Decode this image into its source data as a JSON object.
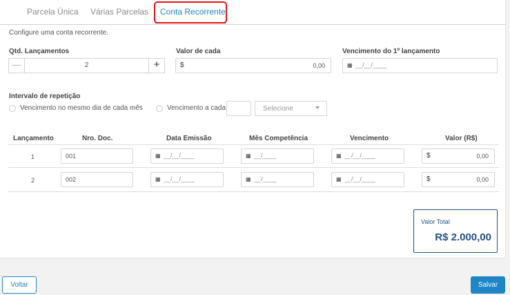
{
  "tabs": [
    "Parcela Única",
    "Várias Parcelas",
    "Conta Recorrente"
  ],
  "description": "Configure uma conta recorrente.",
  "qtd": {
    "label": "Qtd. Lançamentos",
    "minus": "—",
    "plus": "+",
    "value": "2"
  },
  "valor_cada": {
    "label": "Valor de cada",
    "currency": "$",
    "value": "0,00"
  },
  "vencimento_primeiro": {
    "label": "Vencimento do 1º lançamento",
    "placeholder": "__/__/____"
  },
  "intervalo": {
    "label": "Intervalo de repetição",
    "option1": "Vencimento no mesmo dia de cada mês",
    "option2": "Vencimento a cada",
    "select_placeholder": "Selecione"
  },
  "table": {
    "headers": [
      "Lançamento",
      "Nro. Doc.",
      "Data Emissão",
      "Mês Competência",
      "Vencimento",
      "Valor (R$)"
    ],
    "rows": [
      {
        "num": "1",
        "doc": "001",
        "emissao": "__/__/____",
        "competencia": "__/____",
        "vencimento": "__/__/____",
        "currency": "$",
        "valor": "0,00"
      },
      {
        "num": "2",
        "doc": "002",
        "emissao": "__/__/____",
        "competencia": "__/____",
        "vencimento": "__/__/____",
        "currency": "$",
        "valor": "0,00"
      }
    ]
  },
  "total": {
    "label": "Valor Total",
    "value": "R$ 2.000,00"
  },
  "buttons": {
    "voltar": "Voltar",
    "salvar": "Salvar"
  },
  "icons": {
    "calendar": "calendar-icon"
  },
  "colors": {
    "accent": "#1e86c7",
    "highlight": "#e0141b",
    "total": "#23527c"
  }
}
